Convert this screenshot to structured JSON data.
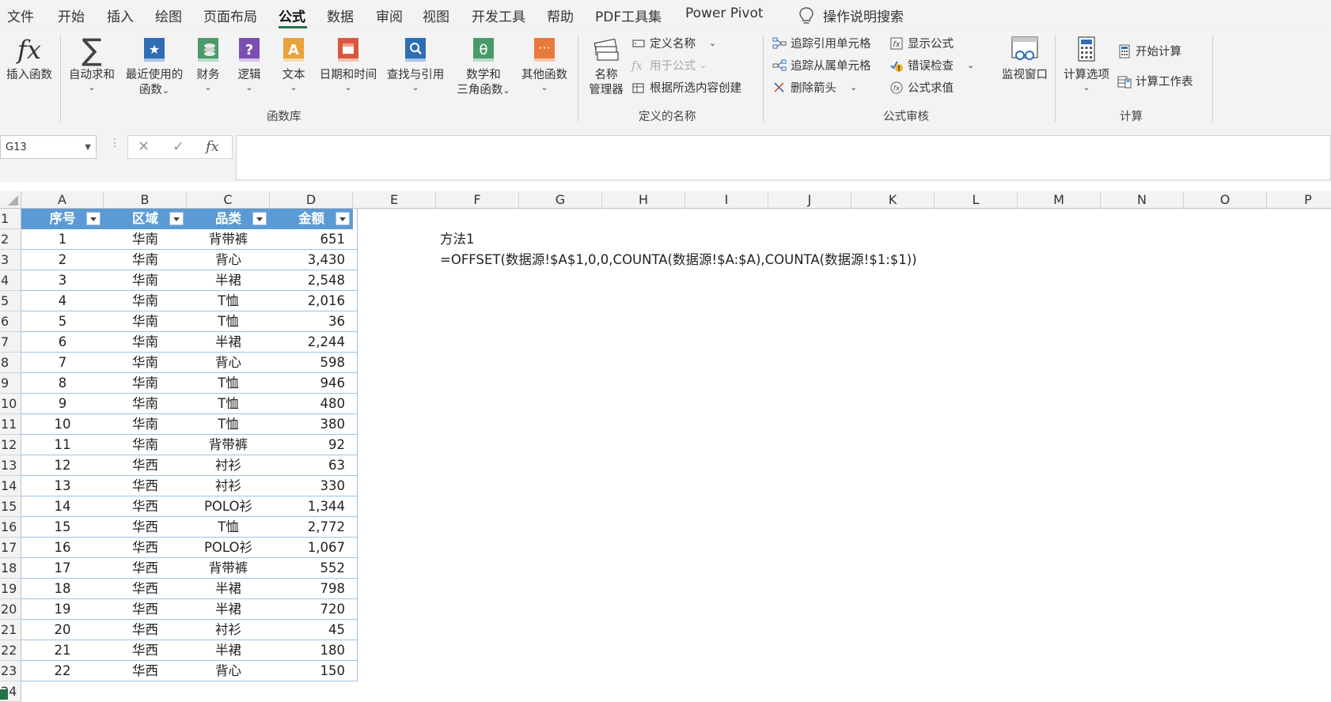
{
  "menu": {
    "items": [
      "文件",
      "开始",
      "插入",
      "绘图",
      "页面布局",
      "公式",
      "数据",
      "审阅",
      "视图",
      "开发工具",
      "帮助",
      "PDF工具集",
      "Power Pivot"
    ],
    "active": "公式",
    "search": "操作说明搜索"
  },
  "ribbon": {
    "function_library": {
      "insert_function": "插入函数",
      "autosum": "自动求和",
      "recent_l1": "最近使用的",
      "recent_l2": "函数",
      "financial": "财务",
      "logical": "逻辑",
      "text": "文本",
      "datetime": "日期和时间",
      "lookup": "查找与引用",
      "math_l1": "数学和",
      "math_l2": "三角函数",
      "other": "其他函数",
      "group_label": "函数库"
    },
    "defined_names": {
      "name_mgr_l1": "名称",
      "name_mgr_l2": "管理器",
      "define_name": "定义名称",
      "use_in_formula": "用于公式",
      "create_from_selection": "根据所选内容创建",
      "group_label": "定义的名称"
    },
    "formula_auditing": {
      "trace_precedents": "追踪引用单元格",
      "trace_dependents": "追踪从属单元格",
      "remove_arrows": "删除箭头",
      "show_formulas": "显示公式",
      "error_checking": "错误检查",
      "evaluate_formula": "公式求值",
      "watch_window": "监视窗口",
      "group_label": "公式审核"
    },
    "calculation": {
      "calc_options": "计算选项",
      "calc_now": "开始计算",
      "calc_sheet": "计算工作表",
      "group_label": "计算"
    }
  },
  "formula_bar": {
    "name_box": "G13",
    "cancel_glyph": "✕",
    "enter_glyph": "✓",
    "fx_glyph": "fx",
    "formula": ""
  },
  "sheet": {
    "columns": [
      "A",
      "B",
      "C",
      "D",
      "E",
      "F",
      "G",
      "H",
      "I",
      "J",
      "K",
      "L",
      "M",
      "N",
      "O",
      "P"
    ],
    "rows": [
      "1",
      "2",
      "3",
      "4",
      "5",
      "6",
      "7",
      "8",
      "9",
      "10",
      "11",
      "12",
      "13",
      "14",
      "15",
      "16",
      "17",
      "18",
      "19",
      "20",
      "21",
      "22",
      "23",
      "24"
    ],
    "table_headers": [
      "序号",
      "区域",
      "品类",
      "金额"
    ],
    "table_rows": [
      [
        "1",
        "华南",
        "背带裤",
        "651"
      ],
      [
        "2",
        "华南",
        "背心",
        "3,430"
      ],
      [
        "3",
        "华南",
        "半裙",
        "2,548"
      ],
      [
        "4",
        "华南",
        "T恤",
        "2,016"
      ],
      [
        "5",
        "华南",
        "T恤",
        "36"
      ],
      [
        "6",
        "华南",
        "半裙",
        "2,244"
      ],
      [
        "7",
        "华南",
        "背心",
        "598"
      ],
      [
        "8",
        "华南",
        "T恤",
        "946"
      ],
      [
        "9",
        "华南",
        "T恤",
        "480"
      ],
      [
        "10",
        "华南",
        "T恤",
        "380"
      ],
      [
        "11",
        "华南",
        "背带裤",
        "92"
      ],
      [
        "12",
        "华西",
        "衬衫",
        "63"
      ],
      [
        "13",
        "华西",
        "衬衫",
        "330"
      ],
      [
        "14",
        "华西",
        "POLO衫",
        "1,344"
      ],
      [
        "15",
        "华西",
        "T恤",
        "2,772"
      ],
      [
        "16",
        "华西",
        "POLO衫",
        "1,067"
      ],
      [
        "17",
        "华西",
        "背带裤",
        "552"
      ],
      [
        "18",
        "华西",
        "半裙",
        "798"
      ],
      [
        "19",
        "华西",
        "半裙",
        "720"
      ],
      [
        "20",
        "华西",
        "衬衫",
        "45"
      ],
      [
        "21",
        "华西",
        "半裙",
        "180"
      ],
      [
        "22",
        "华西",
        "背心",
        "150"
      ]
    ],
    "note_label": "方法1",
    "note_formula": "=OFFSET(数据源!$A$1,0,0,COUNTA(数据源!$A:$A),COUNTA(数据源!$1:$1))"
  },
  "colors": {
    "table_header_bg": "#5b9bd5",
    "accent": "#217346"
  }
}
